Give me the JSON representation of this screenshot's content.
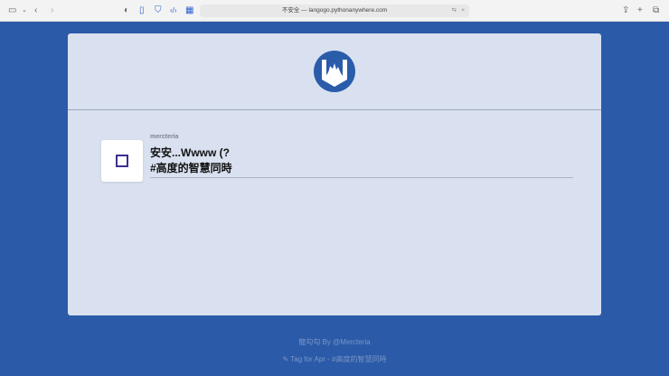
{
  "browser": {
    "url": "不安全 — langogo.pythonanywhere.com"
  },
  "post": {
    "username": "mercteria",
    "title_line1": "安安...Wwww (?",
    "title_line2": "#高度的智慧同時"
  },
  "footer": {
    "credit": "龍勾勾 By @Mercteria",
    "tag": "✎ Tag for Apr - #高度的智慧同時"
  },
  "colors": {
    "background": "#2b5ba8",
    "card": "#d9e1f0",
    "logo": "#2a5caa"
  }
}
